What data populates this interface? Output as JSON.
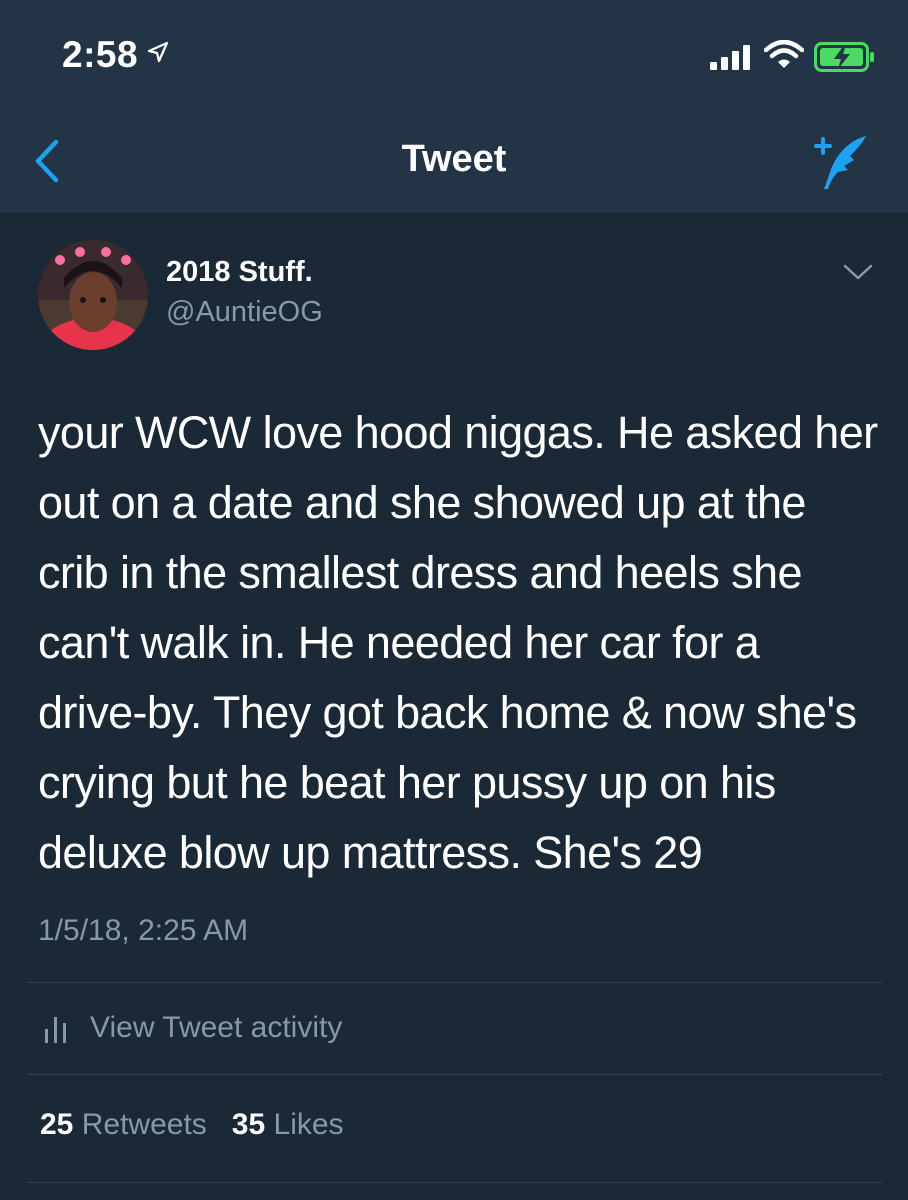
{
  "status_bar": {
    "time": "2:58",
    "icons": [
      "location-arrow-icon",
      "cellular-signal-icon",
      "wifi-icon",
      "battery-charging-icon"
    ]
  },
  "nav": {
    "title": "Tweet",
    "back_icon": "chevron-left-icon",
    "compose_icon": "compose-tweet-icon"
  },
  "tweet": {
    "display_name": "2018 Stuff.",
    "handle": "@AuntieOG",
    "text": "your WCW love hood niggas. He asked her out on a date and she showed up at the crib in the smallest dress and heels she can't walk in. He needed her car for a drive-by. They got back home & now she's crying but he beat her pussy up on his deluxe blow up mattress. She's 29",
    "timestamp": "1/5/18, 2:25 AM"
  },
  "activity": {
    "label": "View Tweet activity",
    "icon": "bar-chart-icon"
  },
  "stats": {
    "retweets_count": "25",
    "retweets_label": "Retweets",
    "likes_count": "35",
    "likes_label": "Likes"
  },
  "colors": {
    "background": "#1b2836",
    "header": "#243447",
    "accent": "#1da1f2",
    "secondary_text": "#8899a6",
    "battery": "#4cd964"
  }
}
